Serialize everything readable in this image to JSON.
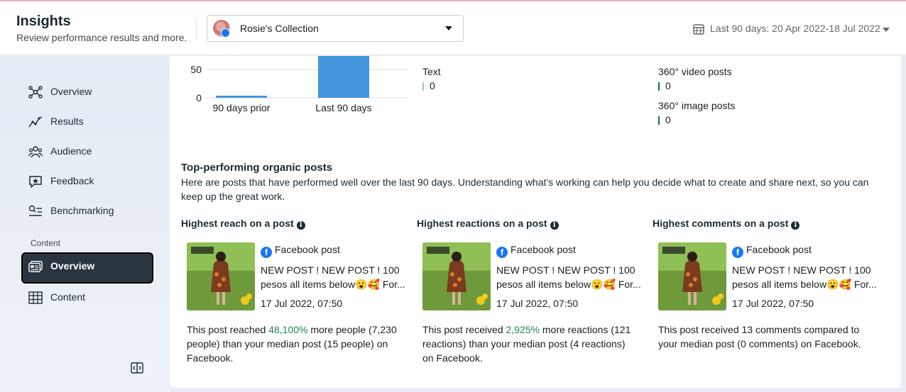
{
  "header": {
    "title": "Insights",
    "subtitle": "Review performance results and more.",
    "account_name": "Rosie's Collection",
    "date_range": "Last 90 days: 20 Apr 2022-18 Jul 2022"
  },
  "sidebar": {
    "items": [
      {
        "label": "Overview",
        "icon": "network-icon"
      },
      {
        "label": "Results",
        "icon": "trend-line-icon"
      },
      {
        "label": "Audience",
        "icon": "people-icon"
      },
      {
        "label": "Feedback",
        "icon": "chat-star-icon"
      },
      {
        "label": "Benchmarking",
        "icon": "search-list-icon"
      }
    ],
    "section_label": "Content",
    "content_items": [
      {
        "label": "Overview",
        "icon": "posts-icon",
        "active": true
      },
      {
        "label": "Content",
        "icon": "table-icon"
      }
    ]
  },
  "chart_data": {
    "type": "bar",
    "categories": [
      "90 days prior",
      "Last 90 days"
    ],
    "values": [
      2,
      100
    ],
    "y_ticks": [
      "50",
      "0"
    ],
    "ylim": [
      0,
      100
    ],
    "colors": [
      "#4296db",
      "#4296db"
    ]
  },
  "formats": {
    "left": [
      {
        "label": "Text",
        "value": "0",
        "color": "#8ec6ec"
      }
    ],
    "right": [
      {
        "label": "360° video posts",
        "value": "0",
        "color": "#0b6e7a"
      },
      {
        "label": "360° image posts",
        "value": "0",
        "color": "#0b6e7a"
      }
    ]
  },
  "top_posts": {
    "title": "Top-performing organic posts",
    "description": "Here are posts that have performed well over the last 90 days. Understanding what's working can help you decide what to create and share next, so you can keep up the great work.",
    "cards": [
      {
        "heading": "Highest reach on a post",
        "post_type": "Facebook post",
        "post_text": "NEW POST ! NEW POST ! 100 pesos all items below😮🥰 For...",
        "post_date": "17 Jul 2022, 07:50",
        "summary_pre": "This post reached ",
        "summary_highlight": "48,100%",
        "summary_post": " more people (7,230 people) than your median post (15 people) on Facebook."
      },
      {
        "heading": "Highest reactions on a post",
        "post_type": "Facebook post",
        "post_text": "NEW POST ! NEW POST ! 100 pesos all items below😮🥰 For...",
        "post_date": "17 Jul 2022, 07:50",
        "summary_pre": "This post received ",
        "summary_highlight": "2,925%",
        "summary_post": " more reactions (121 reactions) than your median post (4 reactions) on Facebook."
      },
      {
        "heading": "Highest comments on a post",
        "post_type": "Facebook post",
        "post_text": "NEW POST ! NEW POST ! 100 pesos all items below😮🥰 For...",
        "post_date": "17 Jul 2022, 07:50",
        "summary_pre": "This post received 13 comments compared to your median post (0 comments) on Facebook.",
        "summary_highlight": "",
        "summary_post": ""
      }
    ]
  }
}
